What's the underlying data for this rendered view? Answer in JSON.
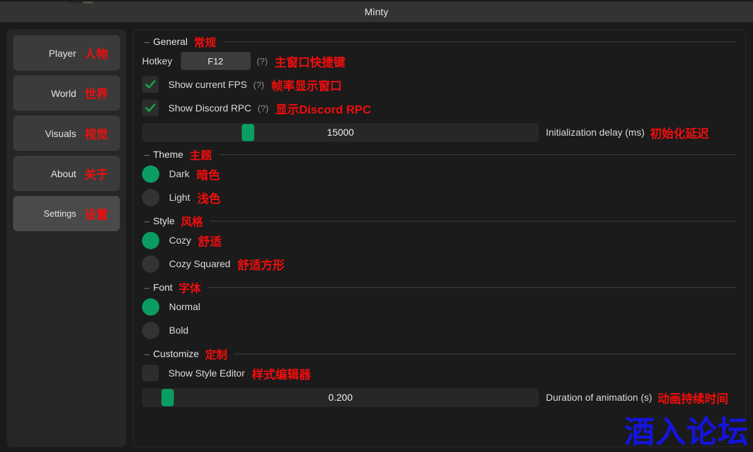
{
  "window": {
    "title": "Minty"
  },
  "sidebar": {
    "items": [
      {
        "label": "Player",
        "label_cn": "人物",
        "active": false
      },
      {
        "label": "World",
        "label_cn": "世界",
        "active": false
      },
      {
        "label": "Visuals",
        "label_cn": "视觉",
        "active": false
      },
      {
        "label": "About",
        "label_cn": "关于",
        "active": false
      },
      {
        "label": "Settings",
        "label_cn": "设置",
        "active": true
      }
    ]
  },
  "sections": {
    "general": {
      "title": "General",
      "title_cn": "常规",
      "collapse_mark": "–",
      "hotkey": {
        "label": "Hotkey",
        "value": "F12",
        "help": "(?)",
        "annotation_cn": "主窗口快捷键"
      },
      "show_fps": {
        "label": "Show current FPS",
        "checked": true,
        "help": "(?)",
        "annotation_cn": "帧率显示窗口"
      },
      "show_discord_rpc": {
        "label": "Show Discord RPC",
        "checked": true,
        "help": "(?)",
        "annotation_cn": "显示Discord RPC"
      },
      "init_delay": {
        "value": "15000",
        "percent": 26,
        "caption": "Initialization delay (ms)",
        "caption_cn": "初始化延迟"
      }
    },
    "theme": {
      "title": "Theme",
      "title_cn": "主题",
      "collapse_mark": "–",
      "options": [
        {
          "label": "Dark",
          "label_cn": "暗色",
          "selected": true
        },
        {
          "label": "Light",
          "label_cn": "浅色",
          "selected": false
        }
      ]
    },
    "style": {
      "title": "Style",
      "title_cn": "风格",
      "collapse_mark": "–",
      "options": [
        {
          "label": "Cozy",
          "label_cn": "舒适",
          "selected": true
        },
        {
          "label": "Cozy Squared",
          "label_cn": "舒适方形",
          "selected": false
        }
      ]
    },
    "font": {
      "title": "Font",
      "title_cn": "字体",
      "collapse_mark": "–",
      "options": [
        {
          "label": "Normal",
          "label_cn": "",
          "selected": true
        },
        {
          "label": "Bold",
          "label_cn": "",
          "selected": false
        }
      ]
    },
    "customize": {
      "title": "Customize",
      "title_cn": "定制",
      "collapse_mark": "–",
      "show_style_editor": {
        "label": "Show Style Editor",
        "checked": false,
        "annotation_cn": "样式编辑器"
      },
      "animation_duration": {
        "value": "0.200",
        "percent": 5,
        "caption": "Duration of animation (s)",
        "caption_cn": "动画持续时间"
      }
    }
  },
  "watermark": {
    "text": "酒入论坛"
  },
  "colors": {
    "accent_green": "#0a9d62",
    "annotation_red": "#f20d0d",
    "watermark_blue": "#1414e0",
    "panel_bg": "#1b1b1b",
    "sidebar_bg": "#262626",
    "titlebar_bg": "#333333"
  }
}
